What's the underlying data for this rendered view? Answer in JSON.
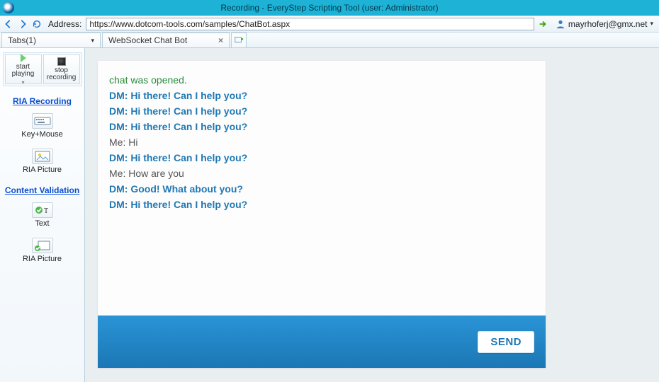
{
  "window": {
    "title": "Recording - EveryStep Scripting Tool (user: Administrator)"
  },
  "address": {
    "label": "Address:",
    "url": "https://www.dotcom-tools.com/samples/ChatBot.aspx",
    "user": "mayrhoferj@gmx.net"
  },
  "tabs": {
    "dropdown_label": "Tabs(1)",
    "page_title": "WebSocket Chat Bot"
  },
  "sidebar": {
    "rec_start_label": "start\nplaying",
    "rec_stop_label": "stop\nrecording",
    "ria_recording_heading": "RIA Recording",
    "ria_keymouse": "Key+Mouse",
    "ria_picture": "RIA Picture",
    "content_validation_heading": "Content Validation",
    "cv_text": "Text",
    "cv_ria_picture": "RIA Picture"
  },
  "chat": {
    "lines": [
      {
        "kind": "opened",
        "text": "chat was opened."
      },
      {
        "kind": "dm",
        "text": "DM: Hi there! Can I help you?"
      },
      {
        "kind": "dm",
        "text": "DM: Hi there! Can I help you?"
      },
      {
        "kind": "dm",
        "text": "DM: Hi there! Can I help you?"
      },
      {
        "kind": "me",
        "text": "Me: Hi"
      },
      {
        "kind": "dm",
        "text": "DM: Hi there! Can I help you?"
      },
      {
        "kind": "me",
        "text": "Me: How are you"
      },
      {
        "kind": "dm",
        "text": "DM: Good! What about you?"
      },
      {
        "kind": "dm",
        "text": "DM: Hi there! Can I help you?"
      }
    ],
    "send_label": "SEND"
  }
}
